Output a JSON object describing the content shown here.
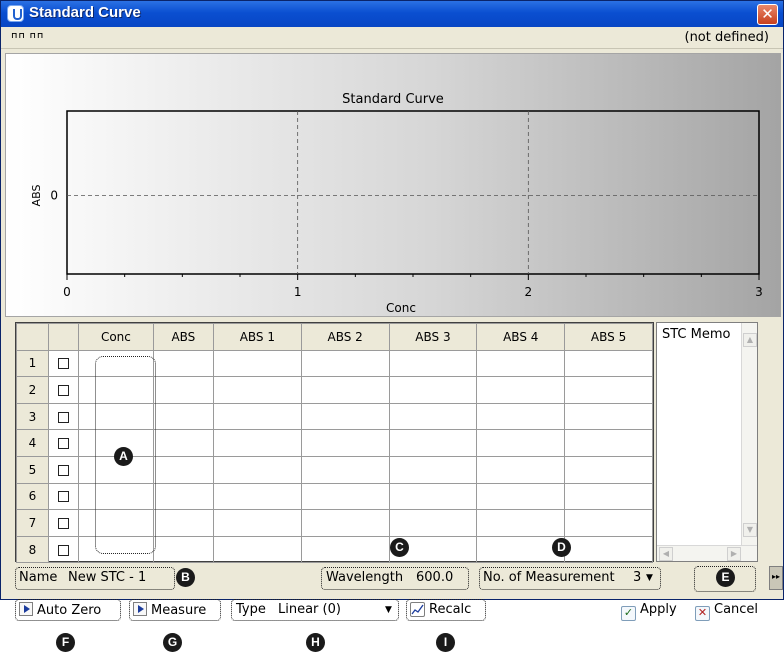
{
  "window": {
    "title": "Standard Curve",
    "close_glyph": "✕"
  },
  "toolbar": {
    "mini_buttons": "⊓⊓ ⊓⊓",
    "status": "(not defined)"
  },
  "chart_data": {
    "type": "scatter",
    "title": "Standard Curve",
    "xlabel": "Conc",
    "ylabel": "ABS",
    "xlim": [
      0,
      3
    ],
    "x_ticks": [
      "0",
      "1",
      "2",
      "3"
    ],
    "y_ticks": [
      "0"
    ],
    "grid": true,
    "series": []
  },
  "table": {
    "columns": [
      "Conc",
      "ABS",
      "ABS 1",
      "ABS 2",
      "ABS 3",
      "ABS 4",
      "ABS 5"
    ],
    "rows": [
      "1",
      "2",
      "3",
      "4",
      "5",
      "6",
      "7",
      "8"
    ]
  },
  "memo": {
    "label": "STC Memo",
    "up": "▲",
    "down": "▼",
    "left": "◀",
    "right": "▶"
  },
  "fields": {
    "name_label": "Name",
    "name_value": "New STC - 1",
    "wavelength_label": "Wavelength",
    "wavelength_value": "600.0",
    "measurement_label": "No. of Measurement",
    "measurement_value": "3",
    "type_label": "Type",
    "type_value": "Linear (0)",
    "dropdown_arrow": "▼",
    "more_glyph": "▸▸"
  },
  "buttons": {
    "auto_zero": "Auto Zero",
    "measure": "Measure",
    "recalc": "Recalc",
    "apply": "Apply",
    "cancel": "Cancel",
    "apply_glyph": "✓",
    "cancel_glyph": "✕"
  },
  "markers": {
    "A": "A",
    "B": "B",
    "C": "C",
    "D": "D",
    "E": "E",
    "F": "F",
    "G": "G",
    "H": "H",
    "I": "I"
  }
}
